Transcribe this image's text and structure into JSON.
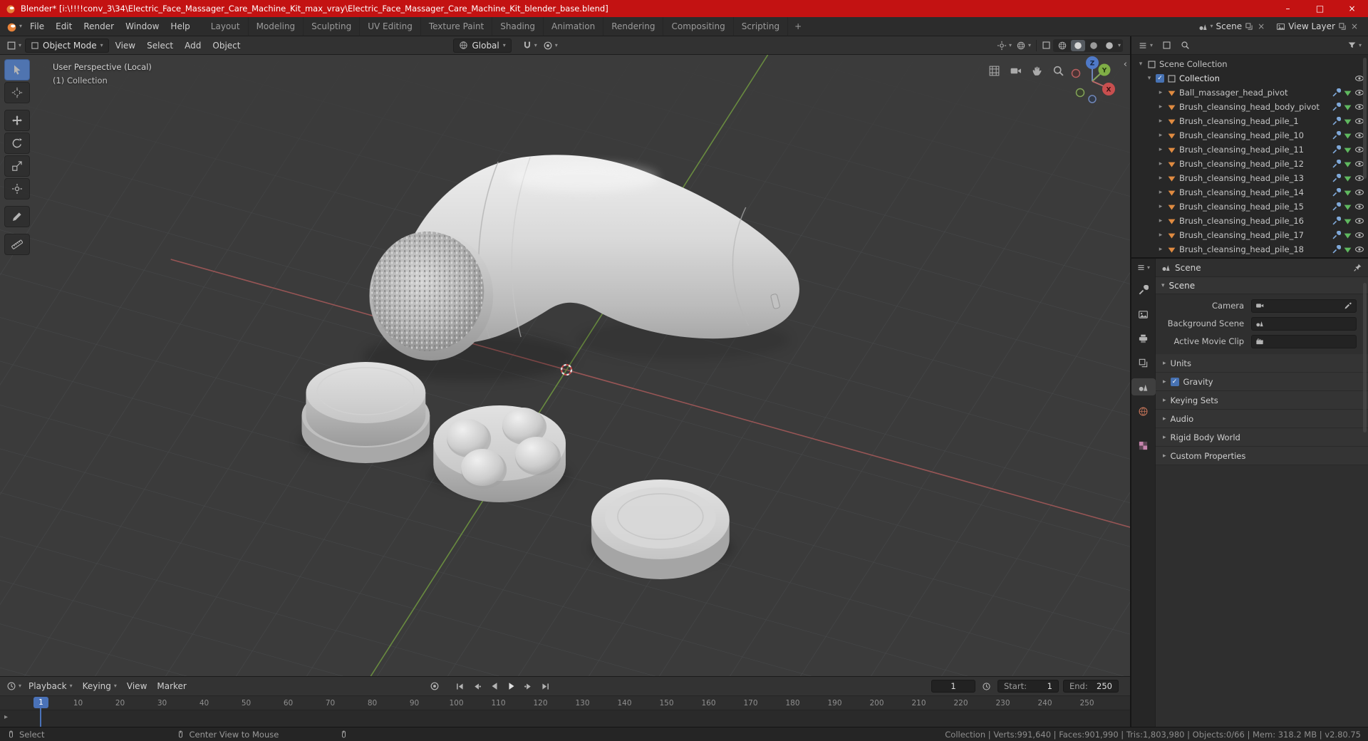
{
  "window": {
    "title": "Blender* [i:\\!!!!conv_3\\34\\Electric_Face_Massager_Care_Machine_Kit_max_vray\\Electric_Face_Massager_Care_Machine_Kit_blender_base.blend]",
    "controls": {
      "minimize": "–",
      "maximize": "□",
      "close": "×"
    }
  },
  "topbar": {
    "menus": [
      "File",
      "Edit",
      "Render",
      "Window",
      "Help"
    ],
    "workspaces": [
      "Layout",
      "Modeling",
      "Sculpting",
      "UV Editing",
      "Texture Paint",
      "Shading",
      "Animation",
      "Rendering",
      "Compositing",
      "Scripting"
    ],
    "active_workspace": "Layout",
    "add_workspace": "+",
    "scene_label": "Scene",
    "view_layer_label": "View Layer"
  },
  "viewport_header": {
    "mode": "Object Mode",
    "menus": [
      "View",
      "Select",
      "Add",
      "Object"
    ],
    "orientation": "Global"
  },
  "viewport": {
    "overlay_line1": "User Perspective (Local)",
    "overlay_line2": "(1) Collection",
    "axis_x": "X",
    "axis_y": "Y",
    "axis_z": "Z"
  },
  "outliner": {
    "scene_collection": "Scene Collection",
    "collection": "Collection",
    "objects": [
      "Ball_massager_head_pivot",
      "Brush_cleansing_head_body_pivot",
      "Brush_cleansing_head_pile_1",
      "Brush_cleansing_head_pile_10",
      "Brush_cleansing_head_pile_11",
      "Brush_cleansing_head_pile_12",
      "Brush_cleansing_head_pile_13",
      "Brush_cleansing_head_pile_14",
      "Brush_cleansing_head_pile_15",
      "Brush_cleansing_head_pile_16",
      "Brush_cleansing_head_pile_17",
      "Brush_cleansing_head_pile_18"
    ]
  },
  "properties": {
    "breadcrumb": "Scene",
    "panel_title": "Scene",
    "camera_label": "Camera",
    "background_scene_label": "Background Scene",
    "active_movie_clip_label": "Active Movie Clip",
    "sections_top": [
      "Units"
    ],
    "gravity_label": "Gravity",
    "sections_bottom": [
      "Keying Sets",
      "Audio",
      "Rigid Body World",
      "Custom Properties"
    ]
  },
  "timeline": {
    "menus": [
      "Playback",
      "Keying",
      "View",
      "Marker"
    ],
    "current_frame": "1",
    "start_label": "Start:",
    "start_value": "1",
    "end_label": "End:",
    "end_value": "250",
    "ticks": [
      "10",
      "20",
      "30",
      "40",
      "50",
      "60",
      "70",
      "80",
      "90",
      "100",
      "110",
      "120",
      "130",
      "140",
      "150",
      "160",
      "170",
      "180",
      "190",
      "200",
      "210",
      "220",
      "230",
      "240",
      "250"
    ]
  },
  "status_bar": {
    "select": "Select",
    "center_view": "Center View to Mouse",
    "stats": "Collection | Verts:991,640 | Faces:901,990 | Tris:1,803,980 | Objects:0/66 | Mem: 318.2 MB | v2.80.75"
  },
  "colors": {
    "titlebar_red": "#c31212",
    "accent_blue": "#4772b3",
    "object_orange": "#e08b41",
    "axis_x_red": "#a85a5a",
    "axis_y_green": "#6e9440",
    "viewport_bg": "#3b3b3b"
  }
}
